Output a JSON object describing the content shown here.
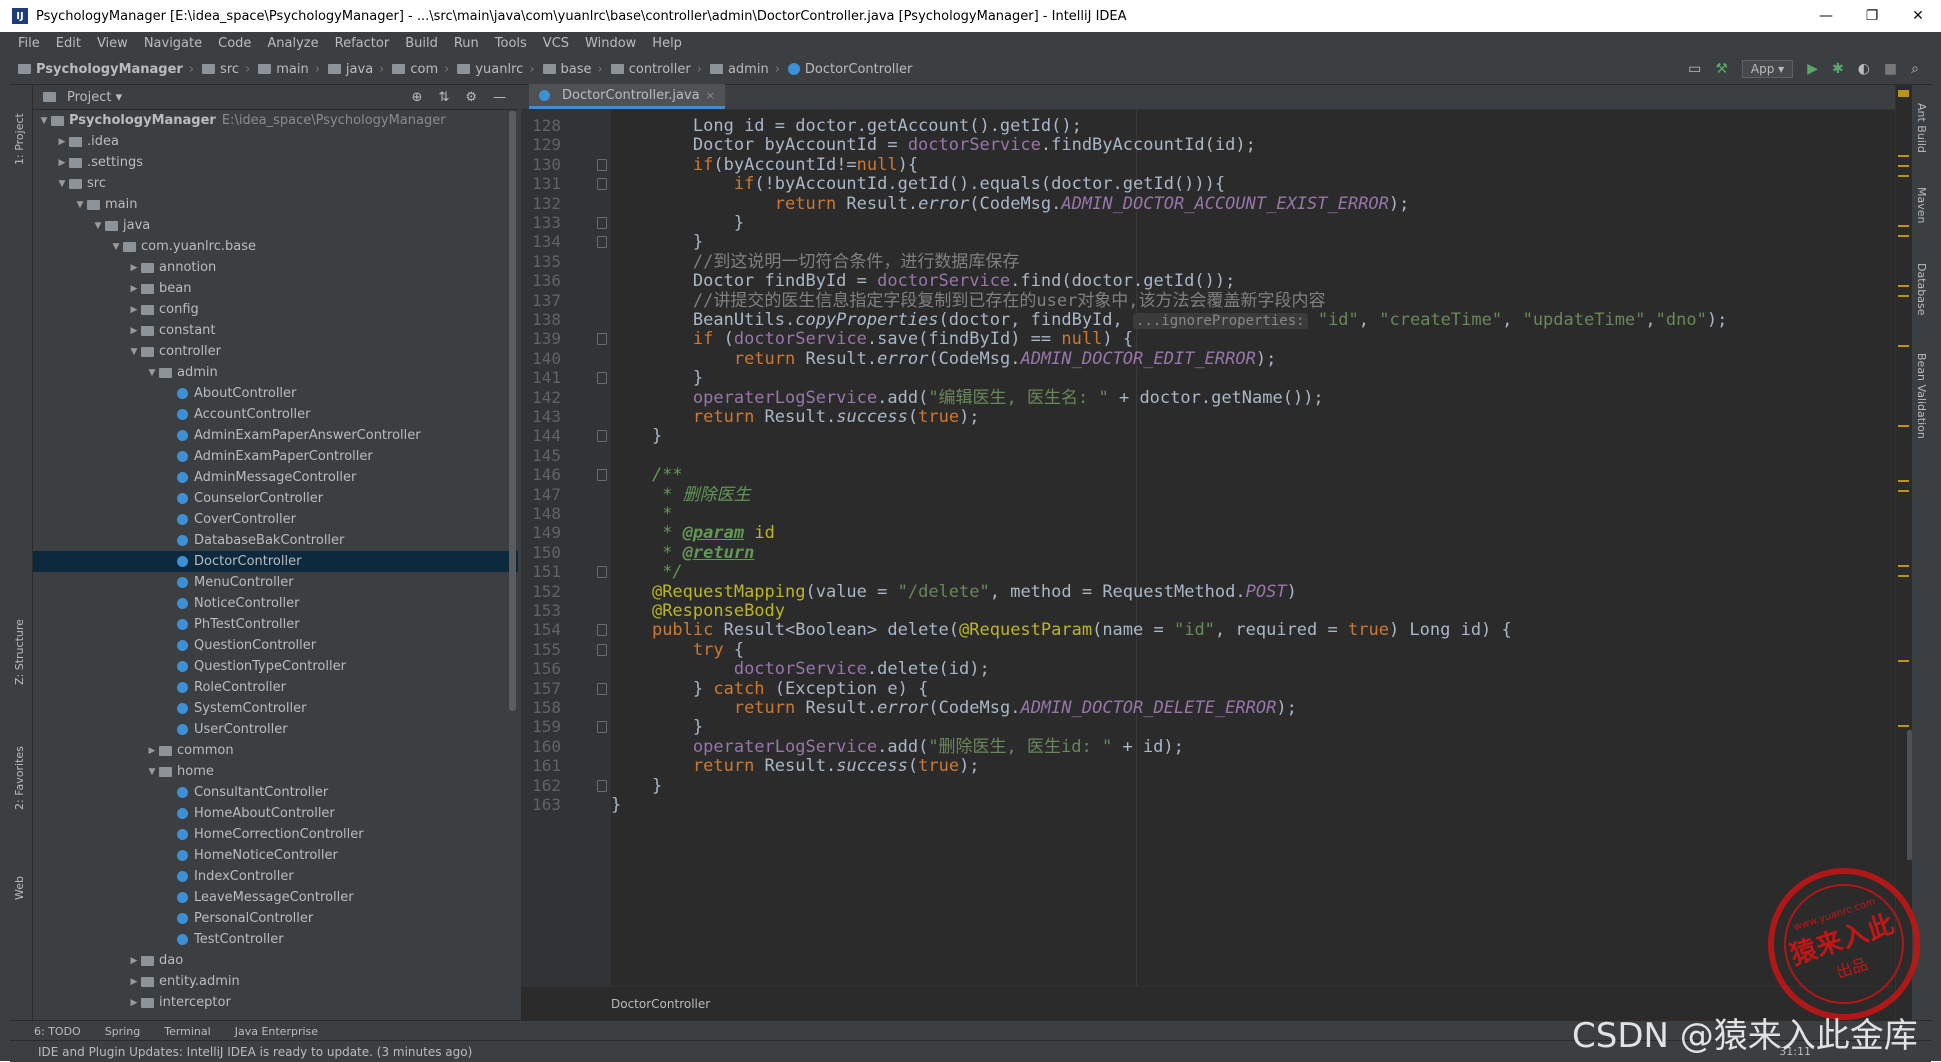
{
  "window": {
    "title": "PsychologyManager [E:\\idea_space\\PsychologyManager] - ...\\src\\main\\java\\com\\yuanlrc\\base\\controller\\admin\\DoctorController.java [PsychologyManager] - IntelliJ IDEA",
    "app_icon": "IJ",
    "minimize": "—",
    "maximize": "❐",
    "close": "✕"
  },
  "menu": [
    "File",
    "Edit",
    "View",
    "Navigate",
    "Code",
    "Analyze",
    "Refactor",
    "Build",
    "Run",
    "Tools",
    "VCS",
    "Window",
    "Help"
  ],
  "breadcrumb": [
    "PsychologyManager",
    "src",
    "main",
    "java",
    "com",
    "yuanlrc",
    "base",
    "controller",
    "admin",
    "DoctorController"
  ],
  "run_config": "App ▾",
  "tool_strip_left": {
    "project": "1: Project",
    "structure": "Z: Structure",
    "favorites": "2: Favorites",
    "web": "Web"
  },
  "tool_strip_right": {
    "ant": "Ant Build",
    "maven": "Maven",
    "database": "Database",
    "bean": "Bean Validation"
  },
  "project_panel": {
    "title": "Project ▾",
    "tree": [
      {
        "label": "PsychologyManager",
        "path": "E:\\idea_space\\PsychologyManager",
        "depth": 0,
        "arrow": "▼",
        "kind": "folder"
      },
      {
        "label": ".idea",
        "depth": 1,
        "arrow": "▶",
        "kind": "folder"
      },
      {
        "label": ".settings",
        "depth": 1,
        "arrow": "▶",
        "kind": "folder"
      },
      {
        "label": "src",
        "depth": 1,
        "arrow": "▼",
        "kind": "folder"
      },
      {
        "label": "main",
        "depth": 2,
        "arrow": "▼",
        "kind": "folder"
      },
      {
        "label": "java",
        "depth": 3,
        "arrow": "▼",
        "kind": "folder"
      },
      {
        "label": "com.yuanlrc.base",
        "depth": 4,
        "arrow": "▼",
        "kind": "folder"
      },
      {
        "label": "annotion",
        "depth": 5,
        "arrow": "▶",
        "kind": "folder"
      },
      {
        "label": "bean",
        "depth": 5,
        "arrow": "▶",
        "kind": "folder"
      },
      {
        "label": "config",
        "depth": 5,
        "arrow": "▶",
        "kind": "folder"
      },
      {
        "label": "constant",
        "depth": 5,
        "arrow": "▶",
        "kind": "folder"
      },
      {
        "label": "controller",
        "depth": 5,
        "arrow": "▼",
        "kind": "folder"
      },
      {
        "label": "admin",
        "depth": 6,
        "arrow": "▼",
        "kind": "folder"
      },
      {
        "label": "AboutController",
        "depth": 7,
        "arrow": "",
        "kind": "class"
      },
      {
        "label": "AccountController",
        "depth": 7,
        "arrow": "",
        "kind": "class"
      },
      {
        "label": "AdminExamPaperAnswerController",
        "depth": 7,
        "arrow": "",
        "kind": "class"
      },
      {
        "label": "AdminExamPaperController",
        "depth": 7,
        "arrow": "",
        "kind": "class"
      },
      {
        "label": "AdminMessageController",
        "depth": 7,
        "arrow": "",
        "kind": "class"
      },
      {
        "label": "CounselorController",
        "depth": 7,
        "arrow": "",
        "kind": "class"
      },
      {
        "label": "CoverController",
        "depth": 7,
        "arrow": "",
        "kind": "class"
      },
      {
        "label": "DatabaseBakController",
        "depth": 7,
        "arrow": "",
        "kind": "class"
      },
      {
        "label": "DoctorController",
        "depth": 7,
        "arrow": "",
        "kind": "class",
        "selected": true
      },
      {
        "label": "MenuController",
        "depth": 7,
        "arrow": "",
        "kind": "class"
      },
      {
        "label": "NoticeController",
        "depth": 7,
        "arrow": "",
        "kind": "class"
      },
      {
        "label": "PhTestController",
        "depth": 7,
        "arrow": "",
        "kind": "class"
      },
      {
        "label": "QuestionController",
        "depth": 7,
        "arrow": "",
        "kind": "class"
      },
      {
        "label": "QuestionTypeController",
        "depth": 7,
        "arrow": "",
        "kind": "class"
      },
      {
        "label": "RoleController",
        "depth": 7,
        "arrow": "",
        "kind": "class"
      },
      {
        "label": "SystemController",
        "depth": 7,
        "arrow": "",
        "kind": "class"
      },
      {
        "label": "UserController",
        "depth": 7,
        "arrow": "",
        "kind": "class"
      },
      {
        "label": "common",
        "depth": 6,
        "arrow": "▶",
        "kind": "folder"
      },
      {
        "label": "home",
        "depth": 6,
        "arrow": "▼",
        "kind": "folder"
      },
      {
        "label": "ConsultantController",
        "depth": 7,
        "arrow": "",
        "kind": "class"
      },
      {
        "label": "HomeAboutController",
        "depth": 7,
        "arrow": "",
        "kind": "class"
      },
      {
        "label": "HomeCorrectionController",
        "depth": 7,
        "arrow": "",
        "kind": "class"
      },
      {
        "label": "HomeNoticeController",
        "depth": 7,
        "arrow": "",
        "kind": "class"
      },
      {
        "label": "IndexController",
        "depth": 7,
        "arrow": "",
        "kind": "class"
      },
      {
        "label": "LeaveMessageController",
        "depth": 7,
        "arrow": "",
        "kind": "class"
      },
      {
        "label": "PersonalController",
        "depth": 7,
        "arrow": "",
        "kind": "class"
      },
      {
        "label": "TestController",
        "depth": 7,
        "arrow": "",
        "kind": "class"
      },
      {
        "label": "dao",
        "depth": 5,
        "arrow": "▶",
        "kind": "folder"
      },
      {
        "label": "entity.admin",
        "depth": 5,
        "arrow": "▶",
        "kind": "folder"
      },
      {
        "label": "interceptor",
        "depth": 5,
        "arrow": "▶",
        "kind": "folder"
      }
    ]
  },
  "editor": {
    "tab_label": "DoctorController.java",
    "tab_close": "×",
    "bottom_breadcrumb": "DoctorController",
    "lines": [
      {
        "n": "128",
        "fold": false,
        "code": [
          [
            "        ",
            ""
          ],
          [
            "Long id = doctor.getAccount().getId();",
            ""
          ]
        ]
      },
      {
        "n": "129",
        "fold": false,
        "code": [
          [
            "        Doctor byAccountId = ",
            ""
          ],
          [
            "doctorService",
            "fld"
          ],
          [
            ".findByAccountId(id);",
            ""
          ]
        ]
      },
      {
        "n": "130",
        "fold": true,
        "code": [
          [
            "        ",
            ""
          ],
          [
            "if",
            "kw"
          ],
          [
            "(byAccountId!=",
            ""
          ],
          [
            "null",
            "kw"
          ],
          [
            "){",
            ""
          ]
        ]
      },
      {
        "n": "131",
        "fold": true,
        "code": [
          [
            "            ",
            ""
          ],
          [
            "if",
            "kw"
          ],
          [
            "(!byAccountId.getId().equals(doctor.getId())){",
            ""
          ]
        ]
      },
      {
        "n": "132",
        "fold": false,
        "code": [
          [
            "                ",
            ""
          ],
          [
            "return ",
            "kw"
          ],
          [
            "Result.",
            ""
          ],
          [
            "error",
            "it"
          ],
          [
            "(CodeMsg.",
            ""
          ],
          [
            "ADMIN_DOCTOR_ACCOUNT_EXIST_ERROR",
            "fi"
          ],
          [
            ");",
            ""
          ]
        ]
      },
      {
        "n": "133",
        "fold": true,
        "code": [
          [
            "            }",
            ""
          ]
        ]
      },
      {
        "n": "134",
        "fold": true,
        "code": [
          [
            "        }",
            ""
          ]
        ]
      },
      {
        "n": "135",
        "fold": false,
        "code": [
          [
            "        ",
            ""
          ],
          [
            "//到这说明一切符合条件，进行数据库保存",
            "cmt"
          ]
        ]
      },
      {
        "n": "136",
        "fold": false,
        "code": [
          [
            "        Doctor findById = ",
            ""
          ],
          [
            "doctorService",
            "fld"
          ],
          [
            ".find(doctor.getId());",
            ""
          ]
        ]
      },
      {
        "n": "137",
        "fold": false,
        "code": [
          [
            "        ",
            ""
          ],
          [
            "//讲提交的医生信息指定字段复制到已存在的user对象中,该方法会覆盖新字段内容",
            "cmt"
          ]
        ]
      },
      {
        "n": "138",
        "fold": false,
        "code": [
          [
            "        BeanUtils.",
            ""
          ],
          [
            "copyProperties",
            "it"
          ],
          [
            "(doctor, findById, ",
            ""
          ],
          [
            "...ignoreProperties:",
            "hint"
          ],
          [
            " ",
            ""
          ],
          [
            "\"id\"",
            "str"
          ],
          [
            ", ",
            ""
          ],
          [
            "\"createTime\"",
            "str"
          ],
          [
            ", ",
            ""
          ],
          [
            "\"updateTime\"",
            "str"
          ],
          [
            ",",
            ""
          ],
          [
            "\"dno\"",
            "str"
          ],
          [
            ");",
            ""
          ]
        ]
      },
      {
        "n": "139",
        "fold": true,
        "code": [
          [
            "        ",
            ""
          ],
          [
            "if ",
            "kw"
          ],
          [
            "(",
            ""
          ],
          [
            "doctorService",
            "fld"
          ],
          [
            ".save(findById) == ",
            ""
          ],
          [
            "null",
            "kw"
          ],
          [
            ") {",
            ""
          ]
        ]
      },
      {
        "n": "140",
        "fold": false,
        "code": [
          [
            "            ",
            ""
          ],
          [
            "return ",
            "kw"
          ],
          [
            "Result.",
            ""
          ],
          [
            "error",
            "it"
          ],
          [
            "(CodeMsg.",
            ""
          ],
          [
            "ADMIN_DOCTOR_EDIT_ERROR",
            "fi"
          ],
          [
            ");",
            ""
          ]
        ]
      },
      {
        "n": "141",
        "fold": true,
        "code": [
          [
            "        }",
            ""
          ]
        ]
      },
      {
        "n": "142",
        "fold": false,
        "code": [
          [
            "        ",
            ""
          ],
          [
            "operaterLogService",
            "fld"
          ],
          [
            ".add(",
            ""
          ],
          [
            "\"编辑医生, 医生名: \"",
            "str"
          ],
          [
            " + doctor.getName());",
            ""
          ]
        ]
      },
      {
        "n": "143",
        "fold": false,
        "code": [
          [
            "        ",
            ""
          ],
          [
            "return ",
            "kw"
          ],
          [
            "Result.",
            ""
          ],
          [
            "success",
            "it"
          ],
          [
            "(",
            ""
          ],
          [
            "true",
            "kw"
          ],
          [
            ");",
            ""
          ]
        ]
      },
      {
        "n": "144",
        "fold": true,
        "code": [
          [
            "    }",
            ""
          ]
        ]
      },
      {
        "n": "145",
        "fold": false,
        "code": [
          [
            "",
            ""
          ]
        ]
      },
      {
        "n": "146",
        "fold": true,
        "code": [
          [
            "    ",
            ""
          ],
          [
            "/**",
            "doc"
          ]
        ]
      },
      {
        "n": "147",
        "fold": false,
        "code": [
          [
            "     ",
            ""
          ],
          [
            "* 删除医生",
            "doc"
          ]
        ]
      },
      {
        "n": "148",
        "fold": false,
        "code": [
          [
            "     ",
            ""
          ],
          [
            "*",
            "doc"
          ]
        ]
      },
      {
        "n": "149",
        "fold": false,
        "code": [
          [
            "     ",
            ""
          ],
          [
            "* ",
            "doc"
          ],
          [
            "@param",
            "tag"
          ],
          [
            " ",
            "doc"
          ],
          [
            "id",
            "ann"
          ]
        ]
      },
      {
        "n": "150",
        "fold": false,
        "code": [
          [
            "     ",
            ""
          ],
          [
            "* ",
            "doc"
          ],
          [
            "@return",
            "tag"
          ]
        ]
      },
      {
        "n": "151",
        "fold": true,
        "code": [
          [
            "     ",
            ""
          ],
          [
            "*/",
            "doc"
          ]
        ]
      },
      {
        "n": "152",
        "fold": false,
        "code": [
          [
            "    ",
            ""
          ],
          [
            "@RequestMapping",
            "ann"
          ],
          [
            "(value = ",
            ""
          ],
          [
            "\"/delete\"",
            "str"
          ],
          [
            ", method = RequestMethod.",
            ""
          ],
          [
            "POST",
            "fi"
          ],
          [
            ")",
            ""
          ]
        ]
      },
      {
        "n": "153",
        "fold": false,
        "code": [
          [
            "    ",
            ""
          ],
          [
            "@ResponseBody",
            "ann"
          ]
        ]
      },
      {
        "n": "154",
        "fold": true,
        "code": [
          [
            "    ",
            ""
          ],
          [
            "public ",
            "kw"
          ],
          [
            "Result<Boolean> delete(",
            ""
          ],
          [
            "@RequestParam",
            "ann"
          ],
          [
            "(name = ",
            ""
          ],
          [
            "\"id\"",
            "str"
          ],
          [
            ", required = ",
            ""
          ],
          [
            "true",
            "kw"
          ],
          [
            ") Long id) {",
            ""
          ]
        ]
      },
      {
        "n": "155",
        "fold": true,
        "code": [
          [
            "        ",
            ""
          ],
          [
            "try ",
            "kw"
          ],
          [
            "{",
            ""
          ]
        ]
      },
      {
        "n": "156",
        "fold": false,
        "code": [
          [
            "            ",
            ""
          ],
          [
            "doctorService",
            "fld"
          ],
          [
            ".delete(id);",
            ""
          ]
        ]
      },
      {
        "n": "157",
        "fold": true,
        "code": [
          [
            "        } ",
            ""
          ],
          [
            "catch ",
            "kw"
          ],
          [
            "(Exception e) {",
            ""
          ]
        ]
      },
      {
        "n": "158",
        "fold": false,
        "code": [
          [
            "            ",
            ""
          ],
          [
            "return ",
            "kw"
          ],
          [
            "Result.",
            ""
          ],
          [
            "error",
            "it"
          ],
          [
            "(CodeMsg.",
            ""
          ],
          [
            "ADMIN_DOCTOR_DELETE_ERROR",
            "fi"
          ],
          [
            ");",
            ""
          ]
        ]
      },
      {
        "n": "159",
        "fold": true,
        "code": [
          [
            "        }",
            ""
          ]
        ]
      },
      {
        "n": "160",
        "fold": false,
        "code": [
          [
            "        ",
            ""
          ],
          [
            "operaterLogService",
            "fld"
          ],
          [
            ".add(",
            ""
          ],
          [
            "\"删除医生, 医生id: \"",
            "str"
          ],
          [
            " + id);",
            ""
          ]
        ]
      },
      {
        "n": "161",
        "fold": false,
        "code": [
          [
            "        ",
            ""
          ],
          [
            "return ",
            "kw"
          ],
          [
            "Result.",
            ""
          ],
          [
            "success",
            "it"
          ],
          [
            "(",
            ""
          ],
          [
            "true",
            "kw"
          ],
          [
            ");",
            ""
          ]
        ]
      },
      {
        "n": "162",
        "fold": true,
        "code": [
          [
            "    }",
            ""
          ]
        ]
      },
      {
        "n": "163",
        "fold": false,
        "code": [
          [
            "}",
            ""
          ]
        ]
      }
    ]
  },
  "bottom_tools": [
    "6: TODO",
    "Spring",
    "Terminal",
    "Java Enterprise"
  ],
  "status": {
    "message": "IDE and Plugin Updates: IntelliJ IDEA is ready to update. (3 minutes ago)",
    "position": "31:11"
  },
  "watermark": {
    "csdn": "CSDN @猿来入此金库",
    "stamp_url": "www.yuanrc.com",
    "stamp_main": "猿来入此",
    "stamp_sub": "出品"
  }
}
